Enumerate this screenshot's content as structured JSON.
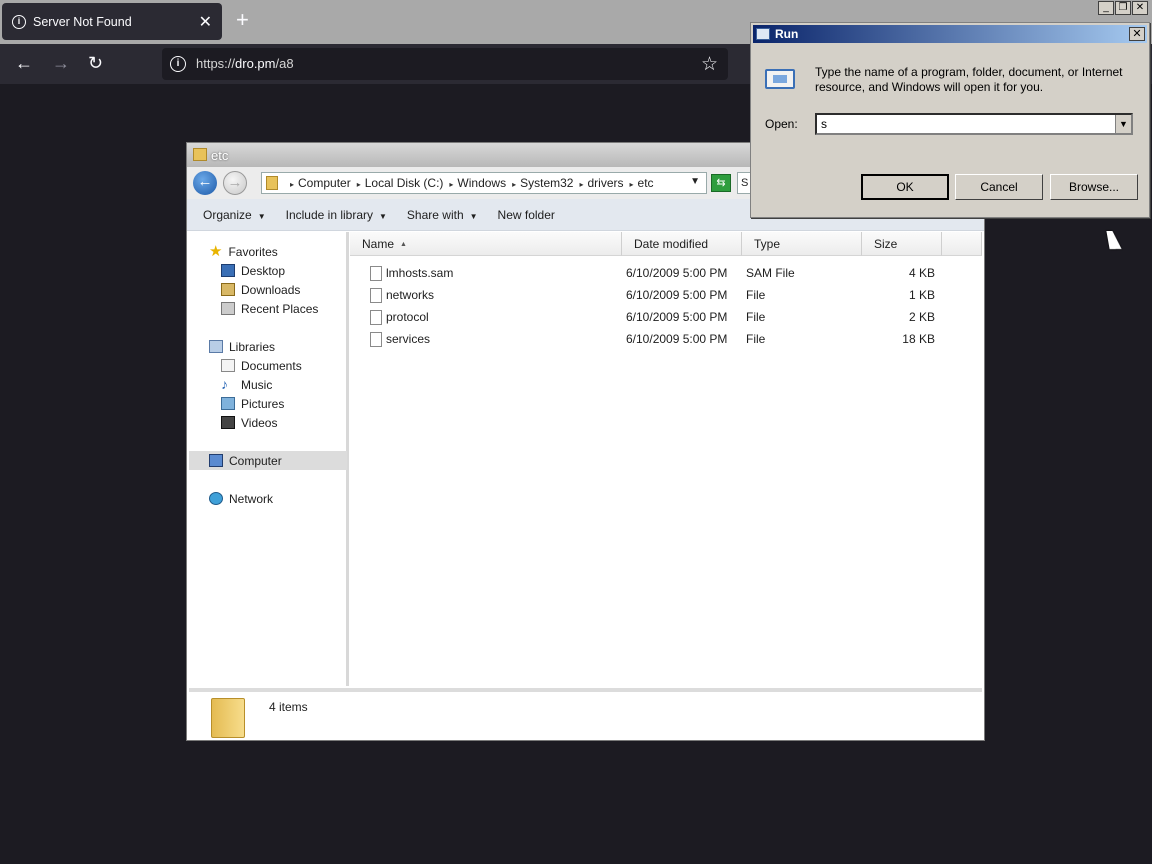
{
  "browser": {
    "tab_title": "Server Not Found",
    "tab_close": "✕",
    "new_tab": "+",
    "url_prefix": "https://",
    "url_host": "dro.pm",
    "url_path": "/a8"
  },
  "explorer": {
    "title": "etc",
    "breadcrumb": [
      "Computer",
      "Local Disk (C:)",
      "Windows",
      "System32",
      "drivers",
      "etc"
    ],
    "search_text": "S",
    "toolbar": {
      "organize": "Organize",
      "include_in_library": "Include in library",
      "share_with": "Share with",
      "new_folder": "New folder"
    },
    "nav": {
      "favorites": "Favorites",
      "desktop": "Desktop",
      "downloads": "Downloads",
      "recent_places": "Recent Places",
      "libraries": "Libraries",
      "documents": "Documents",
      "music": "Music",
      "pictures": "Pictures",
      "videos": "Videos",
      "computer": "Computer",
      "network": "Network"
    },
    "columns": {
      "name": "Name",
      "date_modified": "Date modified",
      "type": "Type",
      "size": "Size"
    },
    "files": [
      {
        "name": "lmhosts.sam",
        "date": "6/10/2009 5:00 PM",
        "type": "SAM File",
        "size": "4 KB"
      },
      {
        "name": "networks",
        "date": "6/10/2009 5:00 PM",
        "type": "File",
        "size": "1 KB"
      },
      {
        "name": "protocol",
        "date": "6/10/2009 5:00 PM",
        "type": "File",
        "size": "2 KB"
      },
      {
        "name": "services",
        "date": "6/10/2009 5:00 PM",
        "type": "File",
        "size": "18 KB"
      }
    ],
    "status": "4 items"
  },
  "run": {
    "title": "Run",
    "description": "Type the name of a program, folder, document, or Internet resource, and Windows will open it for you.",
    "open_label": "Open:",
    "open_value": "s",
    "ok": "OK",
    "cancel": "Cancel",
    "browse": "Browse..."
  }
}
